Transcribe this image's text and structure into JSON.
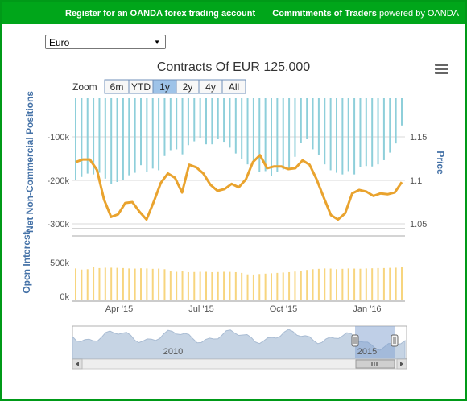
{
  "header": {
    "register_link": "Register for an OANDA forex trading account",
    "cot_title": "Commitments of Traders",
    "powered_by": "powered by OANDA"
  },
  "currency_select": {
    "value": "Euro"
  },
  "chart_title": "Contracts Of EUR 125,000",
  "zoom": {
    "label": "Zoom",
    "buttons": [
      "6m",
      "YTD",
      "1y",
      "2y",
      "4y",
      "All"
    ],
    "selected": "1y"
  },
  "icons": {
    "menu": "menu-icon",
    "scroll_left": "arrow-left-icon",
    "scroll_right": "arrow-right-icon",
    "scroll_grip": "grip-icon"
  },
  "colors": {
    "net": "#8ecfda",
    "price": "#e9a32e",
    "open_interest": "#f7d57e",
    "axis_label": "#4572a7",
    "frame": "#009a18",
    "navigator": "#c6d4e4"
  },
  "chart_data": {
    "type": "bar",
    "x_range": [
      "2015-02-21",
      "2016-02-17"
    ],
    "x_ticks": [
      "Apr '15",
      "Jul '15",
      "Oct '15",
      "Jan '16"
    ],
    "series": [
      {
        "name": "Net Non-Commercial Positions",
        "type": "bar",
        "axis": "left_top",
        "ylabel": "Net Non-Commercial Positions",
        "y_ticks": [
          "-100k",
          "-200k",
          "-300k"
        ],
        "ylim": [
          -310000,
          0
        ],
        "values": [
          -195000,
          -188000,
          -180000,
          -182000,
          -178000,
          -192000,
          -204000,
          -200000,
          -196000,
          -184000,
          -178000,
          -160000,
          -176000,
          -168000,
          -172000,
          -138000,
          -124000,
          -122000,
          -134000,
          -112000,
          -103000,
          -95000,
          -110000,
          -110000,
          -98000,
          -104000,
          -118000,
          -132000,
          -145000,
          -158000,
          -154000,
          -175000,
          -174000,
          -186000,
          -176000,
          -170000,
          -170000,
          -140000,
          -106000,
          -98000,
          -122000,
          -136000,
          -158000,
          -172000,
          -178000,
          -182000,
          -174000,
          -182000,
          -165000,
          -162000,
          -163000,
          -158000,
          -148000,
          -130000,
          -108000,
          -65000
        ]
      },
      {
        "name": "Price",
        "type": "line",
        "axis": "right",
        "ylabel": "Price",
        "y_ticks": [
          "1.15",
          "1.1",
          "1.05"
        ],
        "ylim": [
          1.035,
          1.195
        ],
        "values": [
          1.121,
          1.124,
          1.124,
          1.112,
          1.078,
          1.058,
          1.061,
          1.074,
          1.075,
          1.064,
          1.055,
          1.075,
          1.097,
          1.108,
          1.103,
          1.086,
          1.118,
          1.115,
          1.108,
          1.095,
          1.088,
          1.09,
          1.096,
          1.092,
          1.101,
          1.121,
          1.129,
          1.114,
          1.116,
          1.116,
          1.113,
          1.114,
          1.123,
          1.118,
          1.101,
          1.08,
          1.06,
          1.055,
          1.062,
          1.085,
          1.089,
          1.087,
          1.082,
          1.085,
          1.084,
          1.086,
          1.098
        ]
      },
      {
        "name": "Open Interest",
        "type": "bar",
        "axis": "left_bottom",
        "ylabel": "Open Interest",
        "y_ticks": [
          "500k",
          "0k"
        ],
        "ylim": [
          0,
          600000
        ],
        "values": [
          420000,
          405000,
          410000,
          440000,
          425000,
          430000,
          430000,
          428000,
          425000,
          420000,
          418000,
          422000,
          420000,
          415000,
          418000,
          410000,
          380000,
          375000,
          380000,
          370000,
          372000,
          375000,
          375000,
          370000,
          372000,
          375000,
          374000,
          370000,
          360000,
          340000,
          338000,
          345000,
          350000,
          355000,
          360000,
          365000,
          370000,
          378000,
          388000,
          400000,
          410000,
          415000,
          420000,
          418000,
          410000,
          415000,
          420000,
          418000,
          416000,
          420000,
          422000,
          425000,
          425000,
          428000,
          430000,
          435000
        ]
      }
    ],
    "navigator": {
      "labels": [
        "2010",
        "2015"
      ]
    }
  }
}
